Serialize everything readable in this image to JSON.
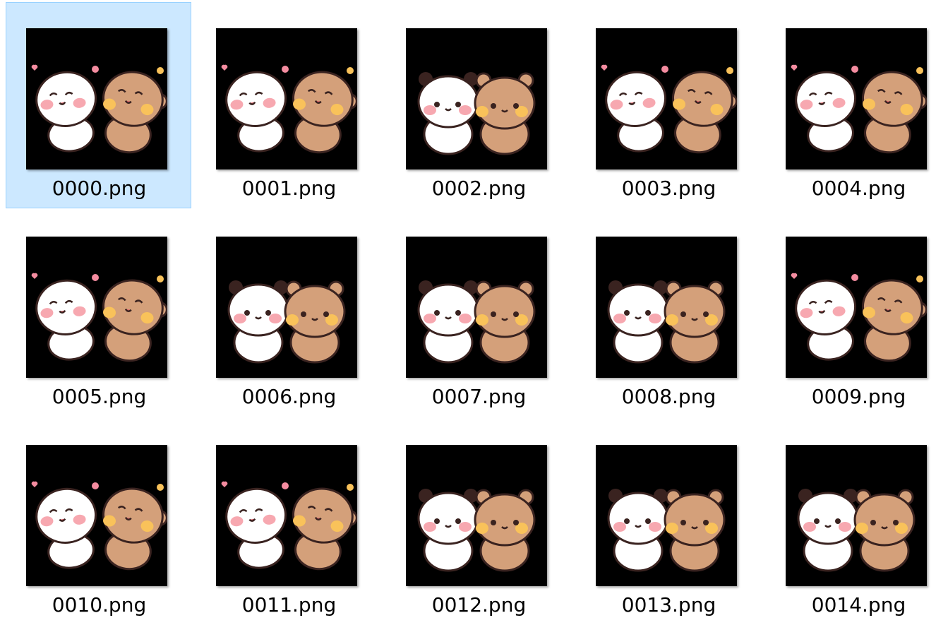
{
  "explorer": {
    "selected_index": 0,
    "items": [
      {
        "filename": "0000.png",
        "pose": "lean"
      },
      {
        "filename": "0001.png",
        "pose": "lean-hearts"
      },
      {
        "filename": "0002.png",
        "pose": "stand"
      },
      {
        "filename": "0003.png",
        "pose": "lean"
      },
      {
        "filename": "0004.png",
        "pose": "lean"
      },
      {
        "filename": "0005.png",
        "pose": "lean"
      },
      {
        "filename": "0006.png",
        "pose": "stand"
      },
      {
        "filename": "0007.png",
        "pose": "stand"
      },
      {
        "filename": "0008.png",
        "pose": "stand"
      },
      {
        "filename": "0009.png",
        "pose": "lean"
      },
      {
        "filename": "0010.png",
        "pose": "lean"
      },
      {
        "filename": "0011.png",
        "pose": "lean-hearts"
      },
      {
        "filename": "0012.png",
        "pose": "stand"
      },
      {
        "filename": "0013.png",
        "pose": "stand"
      },
      {
        "filename": "0014.png",
        "pose": "stand"
      }
    ]
  },
  "colors": {
    "thumb_background": "#000000",
    "selection_fill": "#cce8ff",
    "selection_border": "#99d1ff",
    "panda_body": "#ffffff",
    "bear_body": "#d4a07a",
    "outline": "#3a2320",
    "blush_pink": "#f7a8b0",
    "blush_yellow": "#f9c25a",
    "heart": "#f48ca0"
  }
}
